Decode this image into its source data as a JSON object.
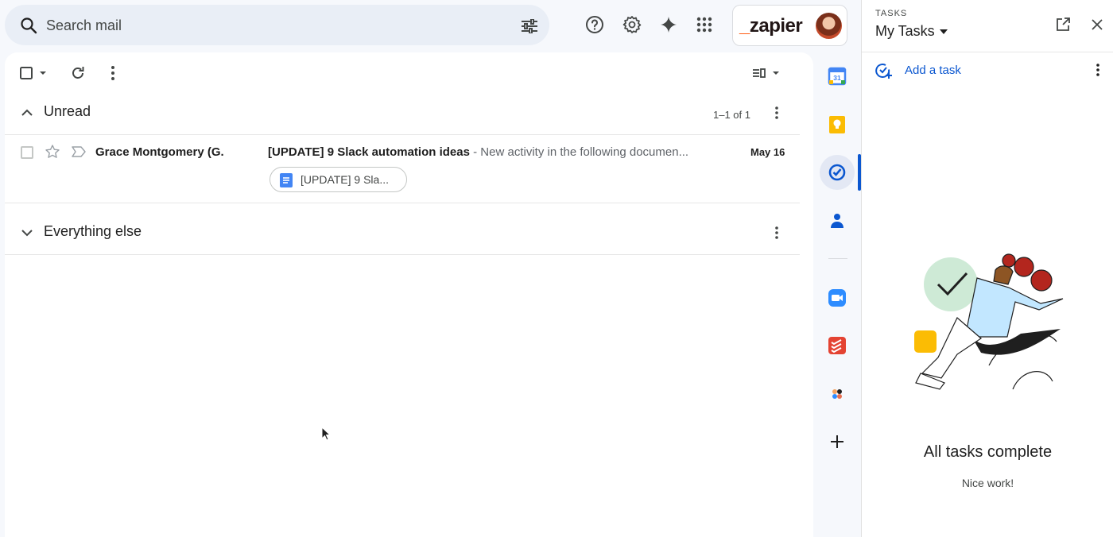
{
  "search": {
    "placeholder": "Search mail"
  },
  "brand": {
    "logo_underscore": "_",
    "logo_text": "zapier"
  },
  "colors": {
    "accent": "#0b57d0",
    "zapier_orange": "#ff4f00",
    "panel_bg": "#f6f8fc"
  },
  "sections": {
    "unread": {
      "label": "Unread",
      "counter": "1–1 of 1"
    },
    "everything_else": {
      "label": "Everything else"
    }
  },
  "emails": [
    {
      "sender": "Grace Montgomery (G.",
      "subject": "[UPDATE] 9 Slack automation ideas",
      "separator": " - ",
      "snippet": "New activity in the following documen...",
      "date": "May 16",
      "attachment": "[UPDATE] 9 Sla..."
    }
  ],
  "tasks": {
    "eyebrow": "TASKS",
    "list_name": "My Tasks",
    "add_label": "Add a task",
    "done_title": "All tasks complete",
    "done_subtitle": "Nice work!"
  },
  "icons": {
    "rail": [
      "calendar-icon",
      "keep-icon",
      "tasks-icon",
      "contacts-icon",
      "zoom-icon",
      "todoist-icon",
      "app-dots-icon",
      "add-addon-icon"
    ],
    "calendar_day": "31"
  }
}
